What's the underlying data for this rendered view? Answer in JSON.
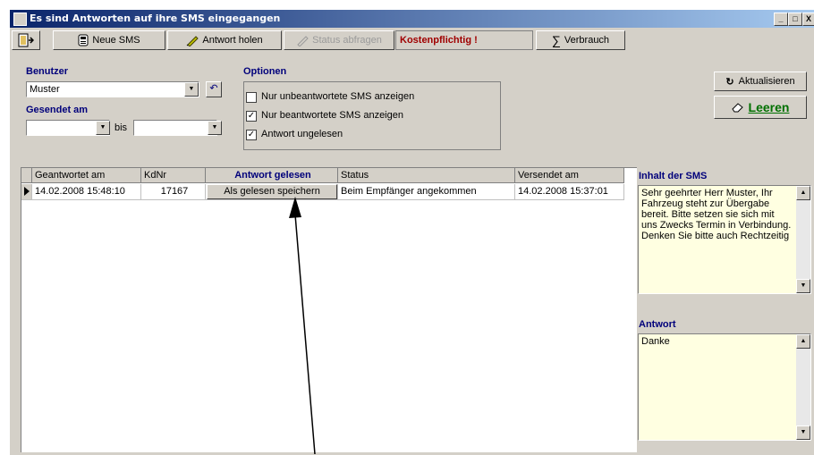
{
  "window": {
    "title": "Es sind Antworten auf ihre SMS eingegangen",
    "controls": [
      "_",
      "□",
      "X"
    ]
  },
  "toolbar": {
    "new_sms": "Neue SMS",
    "fetch_reply": "Antwort holen",
    "query_status": "Status abfragen",
    "cost_warning": "Kostenpflichtig !",
    "usage": "Verbrauch"
  },
  "filters": {
    "user_label": "Benutzer",
    "user_value": "Muster",
    "sent_label": "Gesendet am",
    "date_from": "",
    "to_label": "bis",
    "date_to": ""
  },
  "options": {
    "title": "Optionen",
    "items": [
      {
        "label": "Nur unbeantwortete SMS anzeigen",
        "checked": false
      },
      {
        "label": "Nur beantwortete SMS anzeigen",
        "checked": true
      },
      {
        "label": "Antwort ungelesen",
        "checked": true
      }
    ]
  },
  "actions": {
    "refresh": "Aktualisieren",
    "clear": "Leeren"
  },
  "table": {
    "columns": [
      "Geantwortet am",
      "KdNr",
      "Antwort gelesen",
      "Status",
      "Versendet am"
    ],
    "rows": [
      {
        "answered": "14.02.2008 15:48:10",
        "kdnr": "17167",
        "read_button": "Als gelesen speichern",
        "status": "Beim Empfänger angekommen",
        "sent": "14.02.2008 15:37:01"
      }
    ]
  },
  "sms_panel": {
    "content_label": "Inhalt der SMS",
    "content_text": "Sehr geehrter Herr Muster, Ihr Fahrzeug steht zur Übergabe bereit. Bitte setzen sie sich mit uns Zwecks Termin in Verbindung. Denken Sie bitte auch Rechtzeitig",
    "reply_label": "Antwort",
    "reply_text": "Danke"
  },
  "colors": {
    "title_start": "#0a246a",
    "title_end": "#a6caf0",
    "face": "#d4d0c8",
    "label": "#00007b",
    "warning": "#a00000",
    "memo_bg": "#ffffe1",
    "clear_label": "#007000"
  },
  "icons": [
    "app-icon",
    "exit-icon",
    "phone-icon",
    "pen-icon",
    "sigma-icon",
    "undo-icon",
    "refresh-icon",
    "eraser-icon",
    "row-pointer-icon",
    "annotation-arrow"
  ]
}
